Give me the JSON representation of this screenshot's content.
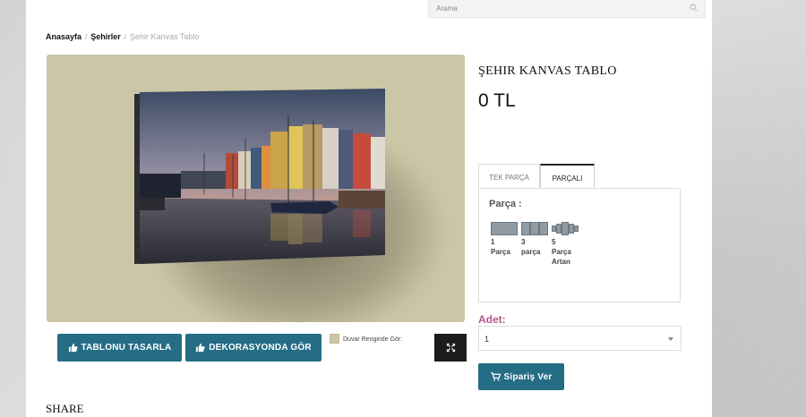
{
  "search": {
    "placeholder": "Arama"
  },
  "breadcrumb": {
    "home": "Anasayfa",
    "cities": "Şehirler",
    "current": "Şehir Kanvas Tablo",
    "separator": "/"
  },
  "product": {
    "title": "ŞEHIR KANVAS TABLO",
    "price": "0 TL"
  },
  "tabs": [
    {
      "label": "TEK PARÇA"
    },
    {
      "label": "PARÇALI"
    }
  ],
  "parca": {
    "label": "Parça :",
    "options": [
      {
        "line1": "1",
        "line2": "Parça",
        "line3": ""
      },
      {
        "line1": "3",
        "line2": "parça",
        "line3": ""
      },
      {
        "line1": "5",
        "line2": "Parça",
        "line3": "Artan"
      }
    ]
  },
  "adet": {
    "label": "Adet:",
    "value": "1"
  },
  "buttons": {
    "design": "TABLONU TASARLA",
    "decor": "DEKORASYONDA GÖR",
    "order": "Sipariş Ver"
  },
  "wall_color": {
    "label": "Duvar Renginde Gör:",
    "color": "#cbc6a6"
  },
  "share": {
    "label": "SHARE"
  },
  "colors": {
    "accent": "#256c85",
    "adet_label": "#b5568c",
    "image_bg": "#cbc6a6"
  }
}
